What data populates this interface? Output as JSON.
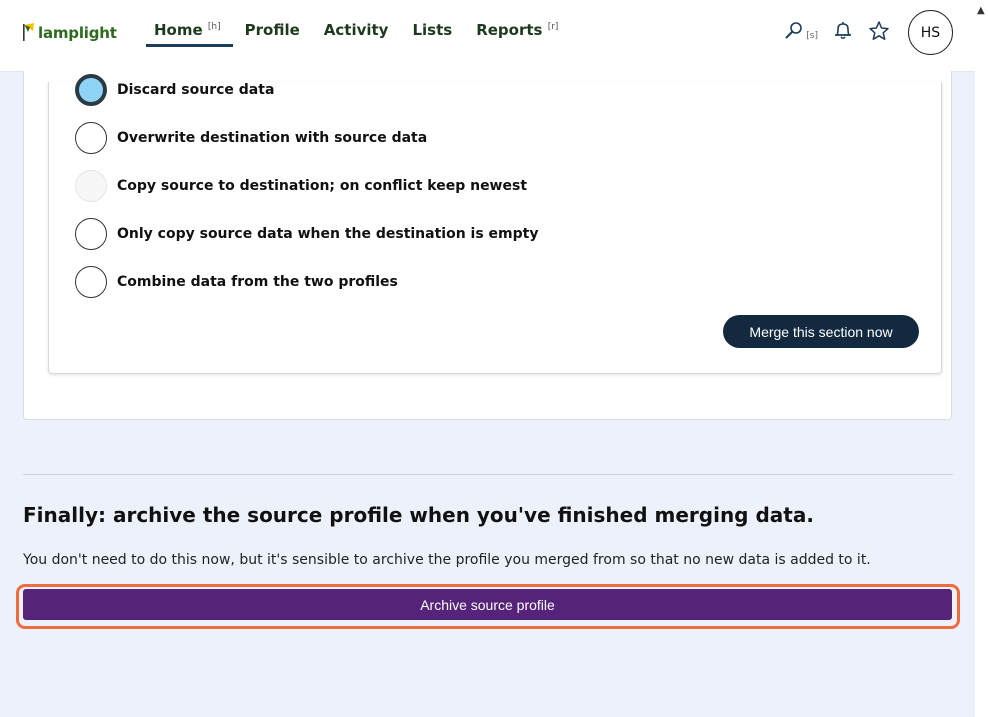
{
  "app": {
    "logo_text": "lamplight"
  },
  "nav": {
    "items": [
      {
        "label": "Home",
        "shortcut": "[h]"
      },
      {
        "label": "Profile",
        "shortcut": ""
      },
      {
        "label": "Activity",
        "shortcut": ""
      },
      {
        "label": "Lists",
        "shortcut": ""
      },
      {
        "label": "Reports",
        "shortcut": "[r]"
      }
    ]
  },
  "tools": {
    "search_shortcut": "[s]",
    "avatar_initials": "HS"
  },
  "merge_options": {
    "options": [
      {
        "label": "Discard source data",
        "state": "selected"
      },
      {
        "label": "Overwrite destination with source data",
        "state": "unselected"
      },
      {
        "label": "Copy source to destination; on conflict keep newest",
        "state": "disabled"
      },
      {
        "label": "Only copy source data when the destination is empty",
        "state": "unselected"
      },
      {
        "label": "Combine data from the two profiles",
        "state": "unselected"
      }
    ],
    "merge_button": "Merge this section now"
  },
  "final": {
    "heading": "Finally: archive the source profile when you've finished merging data.",
    "note": "You don't need to do this now, but it's sensible to archive the profile you merged from so that no new data is added to it.",
    "archive_button": "Archive source profile"
  },
  "colors": {
    "page_bg": "#ecf1fb",
    "nav_text": "#1e3a1e",
    "merge_button": "#12293f",
    "archive_button": "#55237a",
    "focus_ring": "#ef6b3b",
    "selected_radio": "#8fd4f7"
  }
}
